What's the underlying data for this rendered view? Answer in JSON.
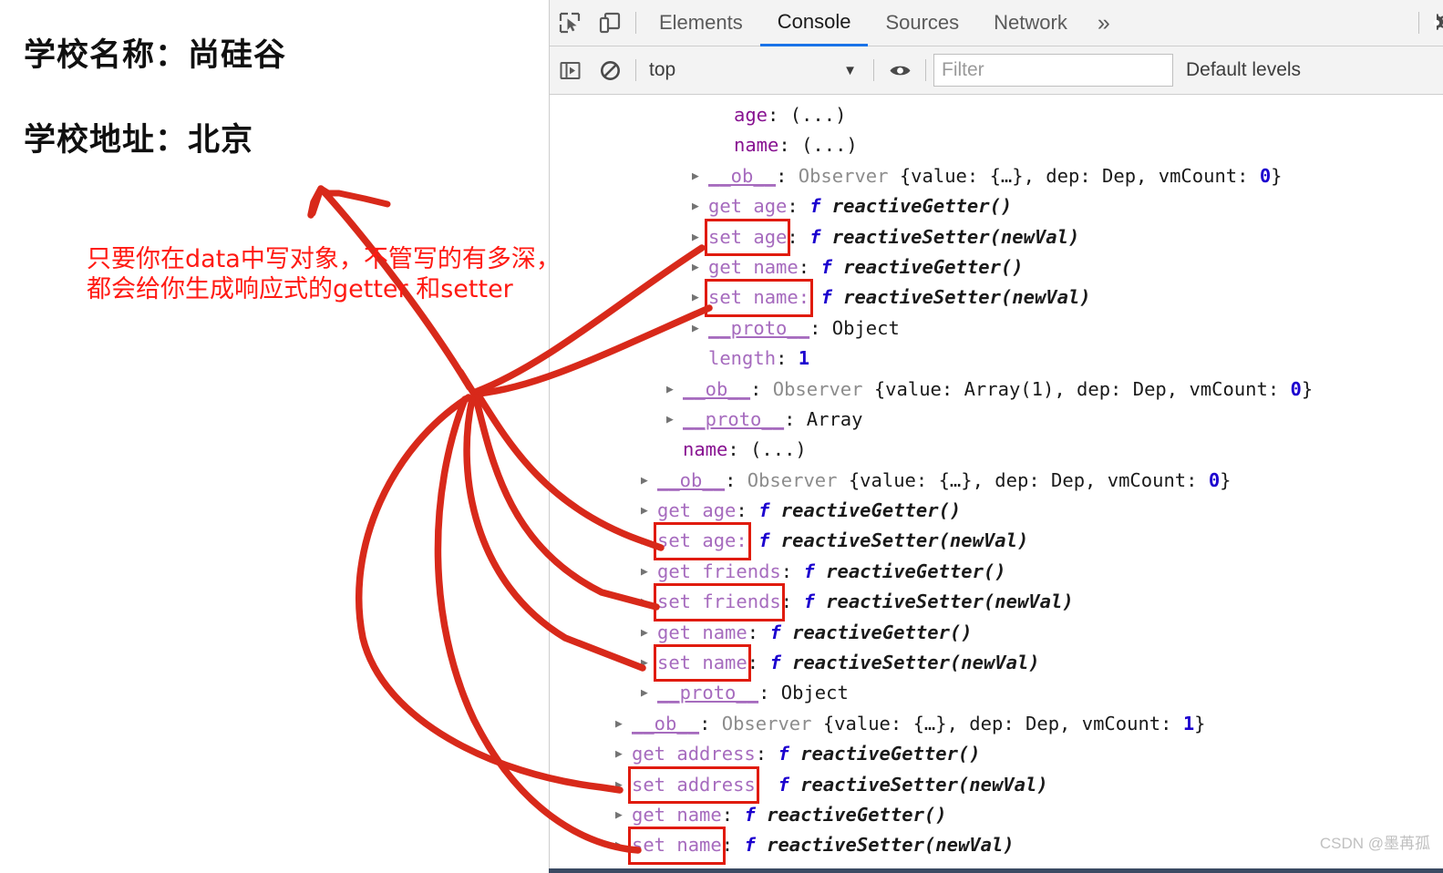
{
  "page": {
    "school_name_line": "学校名称：尚硅谷",
    "school_address_line": "学校地址：北京"
  },
  "annotation": {
    "line1": "只要你在data中写对象，不管写的有多深，",
    "line2": "都会给你生成响应式的getter 和setter",
    "color": "#ff1a13"
  },
  "devtools": {
    "tabs": [
      {
        "label": "Elements",
        "active": false
      },
      {
        "label": "Console",
        "active": true
      },
      {
        "label": "Sources",
        "active": false
      },
      {
        "label": "Network",
        "active": false
      }
    ],
    "more_tabs_glyph": "»",
    "icons": {
      "inspect": "inspect-element-icon",
      "device": "device-toolbar-icon",
      "settings": "gear-icon",
      "sidebar": "console-sidebar-icon",
      "clear": "clear-console-icon",
      "eye": "live-expression-icon"
    },
    "filterbar": {
      "context": "top",
      "context_caret": "▼",
      "filter_placeholder": "Filter",
      "filter_value": "",
      "levels": "Default levels"
    },
    "accent_color": "#1a73e8",
    "highlight_color": "#e01b0c"
  },
  "console_rows": [
    {
      "indent": 5,
      "tri": false,
      "segs": [
        {
          "t": "age",
          "c": "c-key"
        },
        {
          "t": ": ",
          "c": "c-punct"
        },
        {
          "t": "(...)",
          "c": "c-dots"
        }
      ]
    },
    {
      "indent": 5,
      "tri": false,
      "segs": [
        {
          "t": "name",
          "c": "c-key"
        },
        {
          "t": ": ",
          "c": "c-punct"
        },
        {
          "t": "(...)",
          "c": "c-dots"
        }
      ]
    },
    {
      "indent": 4,
      "tri": true,
      "segs": [
        {
          "t": "__ob__",
          "c": "c-key-ul"
        },
        {
          "t": ": ",
          "c": "c-punct"
        },
        {
          "t": "Observer ",
          "c": "c-dim"
        },
        {
          "t": "{value: {…}, dep: ",
          "c": "c-plain"
        },
        {
          "t": "Dep",
          "c": "c-plain"
        },
        {
          "t": ", vmCount: ",
          "c": "c-plain"
        },
        {
          "t": "0",
          "c": "c-num"
        },
        {
          "t": "}",
          "c": "c-plain"
        }
      ]
    },
    {
      "indent": 4,
      "tri": true,
      "segs": [
        {
          "t": "get age",
          "c": "c-key-light"
        },
        {
          "t": ": ",
          "c": "c-punct"
        },
        {
          "t": "f ",
          "c": "c-f"
        },
        {
          "t": "reactiveGetter()",
          "c": "c-fn-italic"
        }
      ]
    },
    {
      "indent": 4,
      "tri": true,
      "hl": "set age",
      "segs": [
        {
          "t": "set age",
          "c": "c-key-light",
          "box": true
        },
        {
          "t": ": ",
          "c": "c-punct"
        },
        {
          "t": "f ",
          "c": "c-f"
        },
        {
          "t": "reactiveSetter(newVal)",
          "c": "c-fn-italic"
        }
      ]
    },
    {
      "indent": 4,
      "tri": true,
      "segs": [
        {
          "t": "get name",
          "c": "c-key-light"
        },
        {
          "t": ": ",
          "c": "c-punct"
        },
        {
          "t": "f ",
          "c": "c-f"
        },
        {
          "t": "reactiveGetter()",
          "c": "c-fn-italic"
        }
      ]
    },
    {
      "indent": 4,
      "tri": true,
      "hl": "set name",
      "segs": [
        {
          "t": "set name:",
          "c": "c-key-light",
          "box": true
        },
        {
          "t": " ",
          "c": "c-punct"
        },
        {
          "t": "f ",
          "c": "c-f"
        },
        {
          "t": "reactiveSetter(newVal)",
          "c": "c-fn-italic"
        }
      ]
    },
    {
      "indent": 4,
      "tri": true,
      "segs": [
        {
          "t": "__proto__",
          "c": "c-key-ul"
        },
        {
          "t": ": ",
          "c": "c-punct"
        },
        {
          "t": "Object",
          "c": "c-plain"
        }
      ]
    },
    {
      "indent": 4,
      "tri": false,
      "segs": [
        {
          "t": "length",
          "c": "c-key-light"
        },
        {
          "t": ": ",
          "c": "c-punct"
        },
        {
          "t": "1",
          "c": "c-num"
        }
      ]
    },
    {
      "indent": 3,
      "tri": true,
      "segs": [
        {
          "t": "__ob__",
          "c": "c-key-ul"
        },
        {
          "t": ": ",
          "c": "c-punct"
        },
        {
          "t": "Observer ",
          "c": "c-dim"
        },
        {
          "t": "{value: Array(",
          "c": "c-plain"
        },
        {
          "t": "1",
          "c": "c-plain"
        },
        {
          "t": "), dep: ",
          "c": "c-plain"
        },
        {
          "t": "Dep",
          "c": "c-plain"
        },
        {
          "t": ", vmCount: ",
          "c": "c-plain"
        },
        {
          "t": "0",
          "c": "c-num"
        },
        {
          "t": "}",
          "c": "c-plain"
        }
      ]
    },
    {
      "indent": 3,
      "tri": true,
      "segs": [
        {
          "t": "__proto__",
          "c": "c-key-ul"
        },
        {
          "t": ": ",
          "c": "c-punct"
        },
        {
          "t": "Array",
          "c": "c-plain"
        }
      ]
    },
    {
      "indent": 3,
      "tri": false,
      "segs": [
        {
          "t": "name",
          "c": "c-key"
        },
        {
          "t": ": ",
          "c": "c-punct"
        },
        {
          "t": "(...)",
          "c": "c-dots"
        }
      ]
    },
    {
      "indent": 2,
      "tri": true,
      "segs": [
        {
          "t": "__ob__",
          "c": "c-key-ul"
        },
        {
          "t": ": ",
          "c": "c-punct"
        },
        {
          "t": "Observer ",
          "c": "c-dim"
        },
        {
          "t": "{value: {…}, dep: ",
          "c": "c-plain"
        },
        {
          "t": "Dep",
          "c": "c-plain"
        },
        {
          "t": ", vmCount: ",
          "c": "c-plain"
        },
        {
          "t": "0",
          "c": "c-num"
        },
        {
          "t": "}",
          "c": "c-plain"
        }
      ]
    },
    {
      "indent": 2,
      "tri": true,
      "segs": [
        {
          "t": "get age",
          "c": "c-key-light"
        },
        {
          "t": ": ",
          "c": "c-punct"
        },
        {
          "t": "f ",
          "c": "c-f"
        },
        {
          "t": "reactiveGetter()",
          "c": "c-fn-italic"
        }
      ]
    },
    {
      "indent": 2,
      "tri": true,
      "hl": "set age",
      "segs": [
        {
          "t": "set age:",
          "c": "c-key-light",
          "box": true
        },
        {
          "t": " ",
          "c": "c-punct"
        },
        {
          "t": "f ",
          "c": "c-f"
        },
        {
          "t": "reactiveSetter(newVal)",
          "c": "c-fn-italic"
        }
      ]
    },
    {
      "indent": 2,
      "tri": true,
      "segs": [
        {
          "t": "get friends",
          "c": "c-key-light"
        },
        {
          "t": ": ",
          "c": "c-punct"
        },
        {
          "t": "f ",
          "c": "c-f"
        },
        {
          "t": "reactiveGetter()",
          "c": "c-fn-italic"
        }
      ]
    },
    {
      "indent": 2,
      "tri": true,
      "hl": "set friends",
      "segs": [
        {
          "t": "set friends",
          "c": "c-key-light",
          "box": true
        },
        {
          "t": ": ",
          "c": "c-punct"
        },
        {
          "t": "f ",
          "c": "c-f"
        },
        {
          "t": "reactiveSetter(newVal)",
          "c": "c-fn-italic"
        }
      ]
    },
    {
      "indent": 2,
      "tri": true,
      "segs": [
        {
          "t": "get name",
          "c": "c-key-light"
        },
        {
          "t": ": ",
          "c": "c-punct"
        },
        {
          "t": "f ",
          "c": "c-f"
        },
        {
          "t": "reactiveGetter()",
          "c": "c-fn-italic"
        }
      ]
    },
    {
      "indent": 2,
      "tri": true,
      "hl": "set name",
      "segs": [
        {
          "t": "set name",
          "c": "c-key-light",
          "box": true
        },
        {
          "t": ": ",
          "c": "c-punct"
        },
        {
          "t": "f ",
          "c": "c-f"
        },
        {
          "t": "reactiveSetter(newVal)",
          "c": "c-fn-italic"
        }
      ]
    },
    {
      "indent": 2,
      "tri": true,
      "segs": [
        {
          "t": "__proto__",
          "c": "c-key-ul"
        },
        {
          "t": ": ",
          "c": "c-punct"
        },
        {
          "t": "Object",
          "c": "c-plain"
        }
      ]
    },
    {
      "indent": 1,
      "tri": true,
      "segs": [
        {
          "t": "__ob__",
          "c": "c-key-ul"
        },
        {
          "t": ": ",
          "c": "c-punct"
        },
        {
          "t": "Observer ",
          "c": "c-dim"
        },
        {
          "t": "{value: {…}, dep: ",
          "c": "c-plain"
        },
        {
          "t": "Dep",
          "c": "c-plain"
        },
        {
          "t": ", vmCount: ",
          "c": "c-plain"
        },
        {
          "t": "1",
          "c": "c-num"
        },
        {
          "t": "}",
          "c": "c-plain"
        }
      ]
    },
    {
      "indent": 1,
      "tri": true,
      "segs": [
        {
          "t": "get address",
          "c": "c-key-light"
        },
        {
          "t": ": ",
          "c": "c-punct"
        },
        {
          "t": "f ",
          "c": "c-f"
        },
        {
          "t": "reactiveGetter()",
          "c": "c-fn-italic"
        }
      ]
    },
    {
      "indent": 1,
      "tri": true,
      "hl": "set address",
      "segs": [
        {
          "t": "set address",
          "c": "c-key-light",
          "box": true
        },
        {
          "t": "  ",
          "c": "c-punct"
        },
        {
          "t": "f ",
          "c": "c-f"
        },
        {
          "t": "reactiveSetter(newVal)",
          "c": "c-fn-italic"
        }
      ]
    },
    {
      "indent": 1,
      "tri": true,
      "segs": [
        {
          "t": "get name",
          "c": "c-key-light"
        },
        {
          "t": ": ",
          "c": "c-punct"
        },
        {
          "t": "f ",
          "c": "c-f"
        },
        {
          "t": "reactiveGetter()",
          "c": "c-fn-italic"
        }
      ]
    },
    {
      "indent": 1,
      "tri": true,
      "hl": "set name",
      "segs": [
        {
          "t": "set name",
          "c": "c-key-light",
          "box": true
        },
        {
          "t": ": ",
          "c": "c-punct"
        },
        {
          "t": "f ",
          "c": "c-f"
        },
        {
          "t": "reactiveSetter(newVal)",
          "c": "c-fn-italic"
        }
      ]
    }
  ],
  "watermark": "CSDN @墨苒孤"
}
